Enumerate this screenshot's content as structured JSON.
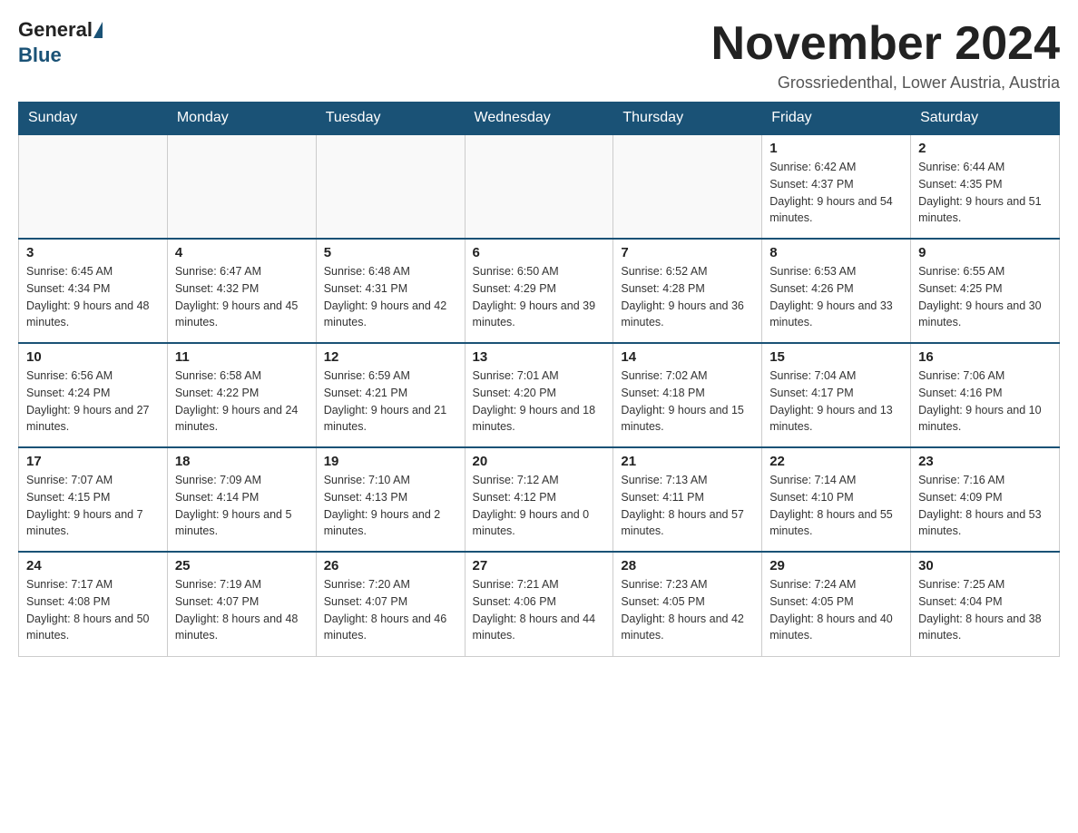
{
  "header": {
    "logo_general": "General",
    "logo_blue": "Blue",
    "month_title": "November 2024",
    "location": "Grossriedenthal, Lower Austria, Austria"
  },
  "days_of_week": [
    "Sunday",
    "Monday",
    "Tuesday",
    "Wednesday",
    "Thursday",
    "Friday",
    "Saturday"
  ],
  "weeks": [
    [
      {
        "day": "",
        "info": ""
      },
      {
        "day": "",
        "info": ""
      },
      {
        "day": "",
        "info": ""
      },
      {
        "day": "",
        "info": ""
      },
      {
        "day": "",
        "info": ""
      },
      {
        "day": "1",
        "info": "Sunrise: 6:42 AM\nSunset: 4:37 PM\nDaylight: 9 hours and 54 minutes."
      },
      {
        "day": "2",
        "info": "Sunrise: 6:44 AM\nSunset: 4:35 PM\nDaylight: 9 hours and 51 minutes."
      }
    ],
    [
      {
        "day": "3",
        "info": "Sunrise: 6:45 AM\nSunset: 4:34 PM\nDaylight: 9 hours and 48 minutes."
      },
      {
        "day": "4",
        "info": "Sunrise: 6:47 AM\nSunset: 4:32 PM\nDaylight: 9 hours and 45 minutes."
      },
      {
        "day": "5",
        "info": "Sunrise: 6:48 AM\nSunset: 4:31 PM\nDaylight: 9 hours and 42 minutes."
      },
      {
        "day": "6",
        "info": "Sunrise: 6:50 AM\nSunset: 4:29 PM\nDaylight: 9 hours and 39 minutes."
      },
      {
        "day": "7",
        "info": "Sunrise: 6:52 AM\nSunset: 4:28 PM\nDaylight: 9 hours and 36 minutes."
      },
      {
        "day": "8",
        "info": "Sunrise: 6:53 AM\nSunset: 4:26 PM\nDaylight: 9 hours and 33 minutes."
      },
      {
        "day": "9",
        "info": "Sunrise: 6:55 AM\nSunset: 4:25 PM\nDaylight: 9 hours and 30 minutes."
      }
    ],
    [
      {
        "day": "10",
        "info": "Sunrise: 6:56 AM\nSunset: 4:24 PM\nDaylight: 9 hours and 27 minutes."
      },
      {
        "day": "11",
        "info": "Sunrise: 6:58 AM\nSunset: 4:22 PM\nDaylight: 9 hours and 24 minutes."
      },
      {
        "day": "12",
        "info": "Sunrise: 6:59 AM\nSunset: 4:21 PM\nDaylight: 9 hours and 21 minutes."
      },
      {
        "day": "13",
        "info": "Sunrise: 7:01 AM\nSunset: 4:20 PM\nDaylight: 9 hours and 18 minutes."
      },
      {
        "day": "14",
        "info": "Sunrise: 7:02 AM\nSunset: 4:18 PM\nDaylight: 9 hours and 15 minutes."
      },
      {
        "day": "15",
        "info": "Sunrise: 7:04 AM\nSunset: 4:17 PM\nDaylight: 9 hours and 13 minutes."
      },
      {
        "day": "16",
        "info": "Sunrise: 7:06 AM\nSunset: 4:16 PM\nDaylight: 9 hours and 10 minutes."
      }
    ],
    [
      {
        "day": "17",
        "info": "Sunrise: 7:07 AM\nSunset: 4:15 PM\nDaylight: 9 hours and 7 minutes."
      },
      {
        "day": "18",
        "info": "Sunrise: 7:09 AM\nSunset: 4:14 PM\nDaylight: 9 hours and 5 minutes."
      },
      {
        "day": "19",
        "info": "Sunrise: 7:10 AM\nSunset: 4:13 PM\nDaylight: 9 hours and 2 minutes."
      },
      {
        "day": "20",
        "info": "Sunrise: 7:12 AM\nSunset: 4:12 PM\nDaylight: 9 hours and 0 minutes."
      },
      {
        "day": "21",
        "info": "Sunrise: 7:13 AM\nSunset: 4:11 PM\nDaylight: 8 hours and 57 minutes."
      },
      {
        "day": "22",
        "info": "Sunrise: 7:14 AM\nSunset: 4:10 PM\nDaylight: 8 hours and 55 minutes."
      },
      {
        "day": "23",
        "info": "Sunrise: 7:16 AM\nSunset: 4:09 PM\nDaylight: 8 hours and 53 minutes."
      }
    ],
    [
      {
        "day": "24",
        "info": "Sunrise: 7:17 AM\nSunset: 4:08 PM\nDaylight: 8 hours and 50 minutes."
      },
      {
        "day": "25",
        "info": "Sunrise: 7:19 AM\nSunset: 4:07 PM\nDaylight: 8 hours and 48 minutes."
      },
      {
        "day": "26",
        "info": "Sunrise: 7:20 AM\nSunset: 4:07 PM\nDaylight: 8 hours and 46 minutes."
      },
      {
        "day": "27",
        "info": "Sunrise: 7:21 AM\nSunset: 4:06 PM\nDaylight: 8 hours and 44 minutes."
      },
      {
        "day": "28",
        "info": "Sunrise: 7:23 AM\nSunset: 4:05 PM\nDaylight: 8 hours and 42 minutes."
      },
      {
        "day": "29",
        "info": "Sunrise: 7:24 AM\nSunset: 4:05 PM\nDaylight: 8 hours and 40 minutes."
      },
      {
        "day": "30",
        "info": "Sunrise: 7:25 AM\nSunset: 4:04 PM\nDaylight: 8 hours and 38 minutes."
      }
    ]
  ]
}
